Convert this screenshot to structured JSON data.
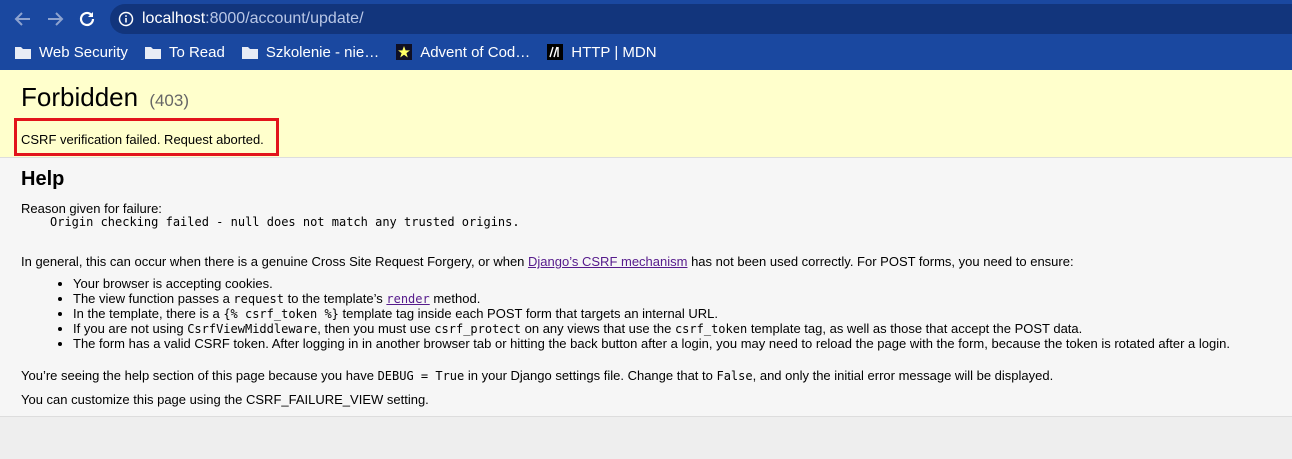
{
  "browser": {
    "url_host": "localhost",
    "url_path": ":8000/account/update/",
    "bookmarks": [
      {
        "label": "Web Security",
        "icon": "folder-icon"
      },
      {
        "label": "To Read",
        "icon": "folder-icon"
      },
      {
        "label": "Szkolenie - nie…",
        "icon": "folder-icon"
      },
      {
        "label": "Advent of Cod…",
        "icon": "advent-star-icon"
      },
      {
        "label": "HTTP | MDN",
        "icon": "mdn-icon"
      }
    ]
  },
  "summary": {
    "title": "Forbidden",
    "code": "(403)",
    "message": "CSRF verification failed. Request aborted."
  },
  "help": {
    "heading": "Help",
    "reason_label": "Reason given for failure:",
    "reason": "Origin checking failed - null does not match any trusted origins.",
    "intro_before": "In general, this can occur when there is a genuine Cross Site Request Forgery, or when ",
    "intro_link": "Django’s CSRF mechanism",
    "intro_after": " has not been used correctly. For POST forms, you need to ensure:",
    "items": {
      "cookies": "Your browser is accepting cookies.",
      "view_a": "The view function passes a ",
      "view_code": "request",
      "view_b": " to the template’s ",
      "view_link": "render",
      "view_c": " method.",
      "tmpl_a": "In the template, there is a ",
      "tmpl_code": "{% csrf_token %}",
      "tmpl_b": " template tag inside each POST form that targets an internal URL.",
      "mw_a": "If you are not using ",
      "mw_code1": "CsrfViewMiddleware",
      "mw_b": ", then you must use ",
      "mw_code2": "csrf_protect",
      "mw_c": " on any views that use the ",
      "mw_code3": "csrf_token",
      "mw_d": " template tag, as well as those that accept the POST data.",
      "token": "The form has a valid CSRF token. After logging in in another browser tab or hitting the back button after a login, you may need to reload the page with the form, because the token is rotated after a login."
    },
    "debug_a": "You’re seeing the help section of this page because you have ",
    "debug_code1": "DEBUG = True",
    "debug_b": " in your Django settings file. Change that to ",
    "debug_code2": "False",
    "debug_c": ", and only the initial error message will be displayed.",
    "customize": "You can customize this page using the CSRF_FAILURE_VIEW setting."
  },
  "colors": {
    "chrome": "#1a48a0",
    "summary_bg": "#ffffcc",
    "highlight_box": "#e2141b",
    "link": "#551a8b"
  }
}
